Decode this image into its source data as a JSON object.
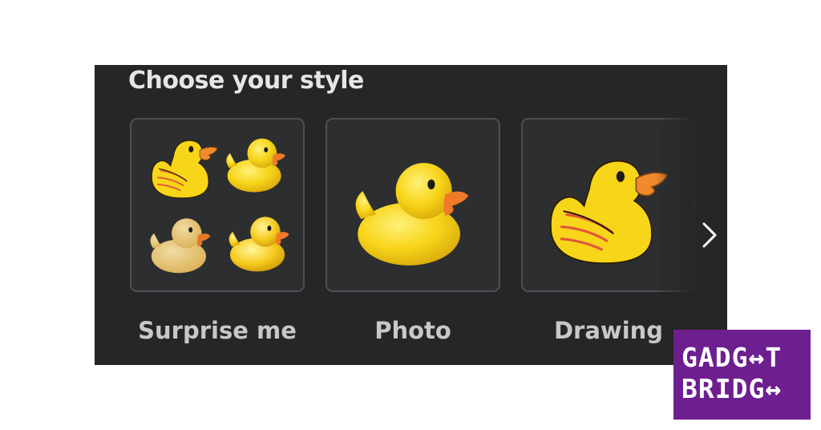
{
  "panel": {
    "title": "Choose your style",
    "styles": [
      {
        "label": "Surprise me",
        "icon": "duck-collage-icon"
      },
      {
        "label": "Photo",
        "icon": "duck-photo-icon"
      },
      {
        "label": "Drawing",
        "icon": "duck-drawing-icon"
      }
    ],
    "next_icon": "chevron-right-icon"
  },
  "watermark": {
    "line1": "GADG↔T",
    "line2": "BRIDG↔"
  },
  "colors": {
    "panel_bg": "#252627",
    "card_border": "#4d4f52",
    "duck_yellow": "#f7d518",
    "beak_orange": "#ef7d2d",
    "logo_purple": "#6e1f8f"
  }
}
